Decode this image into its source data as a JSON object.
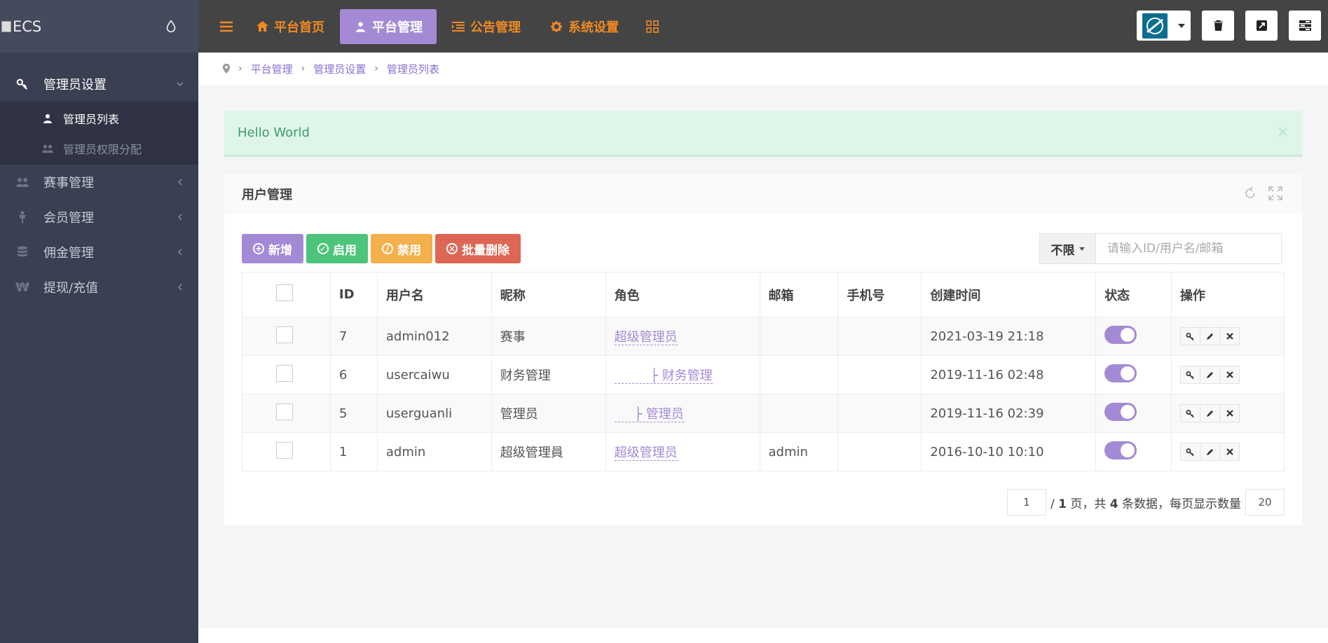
{
  "logo": {
    "text": "ECS"
  },
  "sidebar": {
    "items": [
      {
        "label": "管理员设置",
        "icon": "key-icon",
        "expanded": true,
        "children": [
          {
            "label": "管理员列表",
            "icon": "user-icon",
            "active": true
          },
          {
            "label": "管理员权限分配",
            "icon": "users-icon",
            "active": false
          }
        ]
      },
      {
        "label": "赛事管理",
        "icon": "users-icon"
      },
      {
        "label": "会员管理",
        "icon": "person-icon"
      },
      {
        "label": "佣金管理",
        "icon": "database-icon"
      },
      {
        "label": "提现/充值",
        "icon": "won-icon"
      }
    ]
  },
  "topnav": {
    "tabs": [
      {
        "label": "平台首页",
        "icon": "home-icon",
        "active": false
      },
      {
        "label": "平台管理",
        "icon": "user-icon",
        "active": true
      },
      {
        "label": "公告管理",
        "icon": "list-icon",
        "active": false
      },
      {
        "label": "系统设置",
        "icon": "gear-icon",
        "active": false
      }
    ]
  },
  "breadcrumb": [
    "平台管理",
    "管理员设置",
    "管理员列表"
  ],
  "alert": {
    "message": "Hello World",
    "close": "×"
  },
  "panel": {
    "title": "用户管理",
    "toolbar": {
      "add": "新增",
      "enable": "启用",
      "disable": "禁用",
      "batch_delete": "批量删除"
    },
    "search": {
      "filter": "不限",
      "placeholder": "请输入ID/用户名/邮箱"
    },
    "table": {
      "headers": [
        "ID",
        "用户名",
        "昵称",
        "角色",
        "邮箱",
        "手机号",
        "创建时间",
        "状态",
        "操作"
      ],
      "rows": [
        {
          "id": "7",
          "username": "admin012",
          "nickname": "赛事",
          "role": "超级管理员",
          "email": "",
          "phone": "",
          "created": "2021-03-19 21:18"
        },
        {
          "id": "6",
          "username": "usercaiwu",
          "nickname": "财务管理",
          "role": "         ├ 财务管理",
          "email": "",
          "phone": "",
          "created": "2019-11-16 02:48"
        },
        {
          "id": "5",
          "username": "userguanli",
          "nickname": "管理员",
          "role": "     ├ 管理员",
          "email": "",
          "phone": "",
          "created": "2019-11-16 02:39"
        },
        {
          "id": "1",
          "username": "admin",
          "nickname": "超级管理員",
          "role": "超级管理员",
          "email": "admin",
          "phone": "",
          "created": "2016-10-10 10:10"
        }
      ]
    },
    "pager": {
      "current": "1",
      "total_pages": "1",
      "total_rows": "4",
      "per_page": "20",
      "text_pages_prefix": "/ ",
      "text_pages_suffix": " 页，共 ",
      "text_rows_suffix": " 条数据，每页显示数量"
    }
  },
  "colors": {
    "accent": "#a48ad4",
    "nav_orange": "#f08a24",
    "sidebar": "#3a3f51",
    "topbar": "#444444"
  }
}
